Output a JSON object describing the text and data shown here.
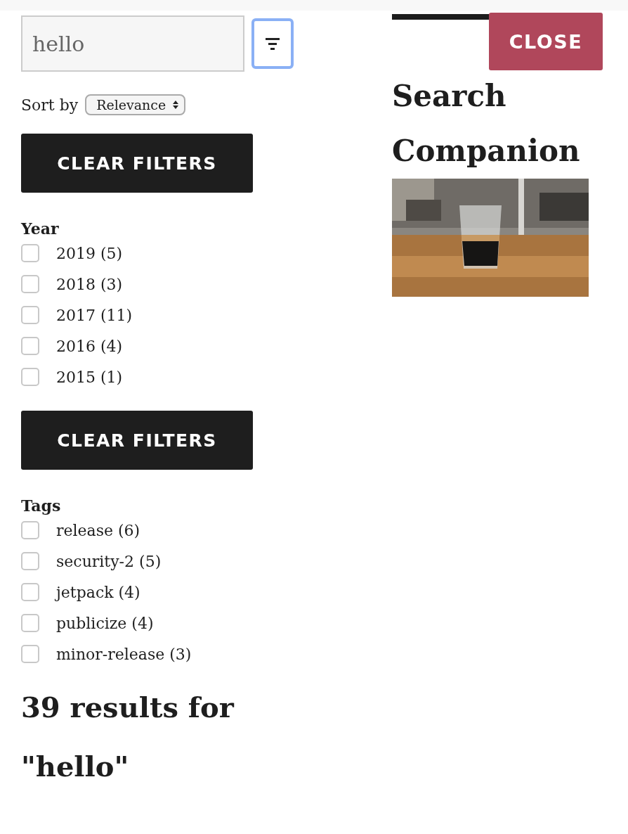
{
  "search": {
    "value": "hello"
  },
  "sort": {
    "label": "Sort by",
    "value": "Relevance"
  },
  "filter_groups": [
    {
      "button": "CLEAR FILTERS",
      "title": "Year",
      "options": [
        {
          "label": "2019 (5)",
          "checked": false
        },
        {
          "label": "2018 (3)",
          "checked": false
        },
        {
          "label": "2017 (11)",
          "checked": false
        },
        {
          "label": "2016 (4)",
          "checked": false
        },
        {
          "label": "2015 (1)",
          "checked": false
        }
      ]
    },
    {
      "button": "CLEAR FILTERS",
      "title": "Tags",
      "options": [
        {
          "label": "release (6)",
          "checked": false
        },
        {
          "label": "security-2 (5)",
          "checked": false
        },
        {
          "label": "jetpack (4)",
          "checked": false
        },
        {
          "label": "publicize (4)",
          "checked": false
        },
        {
          "label": "minor-release (3)",
          "checked": false
        }
      ]
    }
  ],
  "results_heading": "39 results for \"hello\"",
  "sidebar": {
    "title": "Search Companion"
  },
  "close_button": "CLOSE"
}
